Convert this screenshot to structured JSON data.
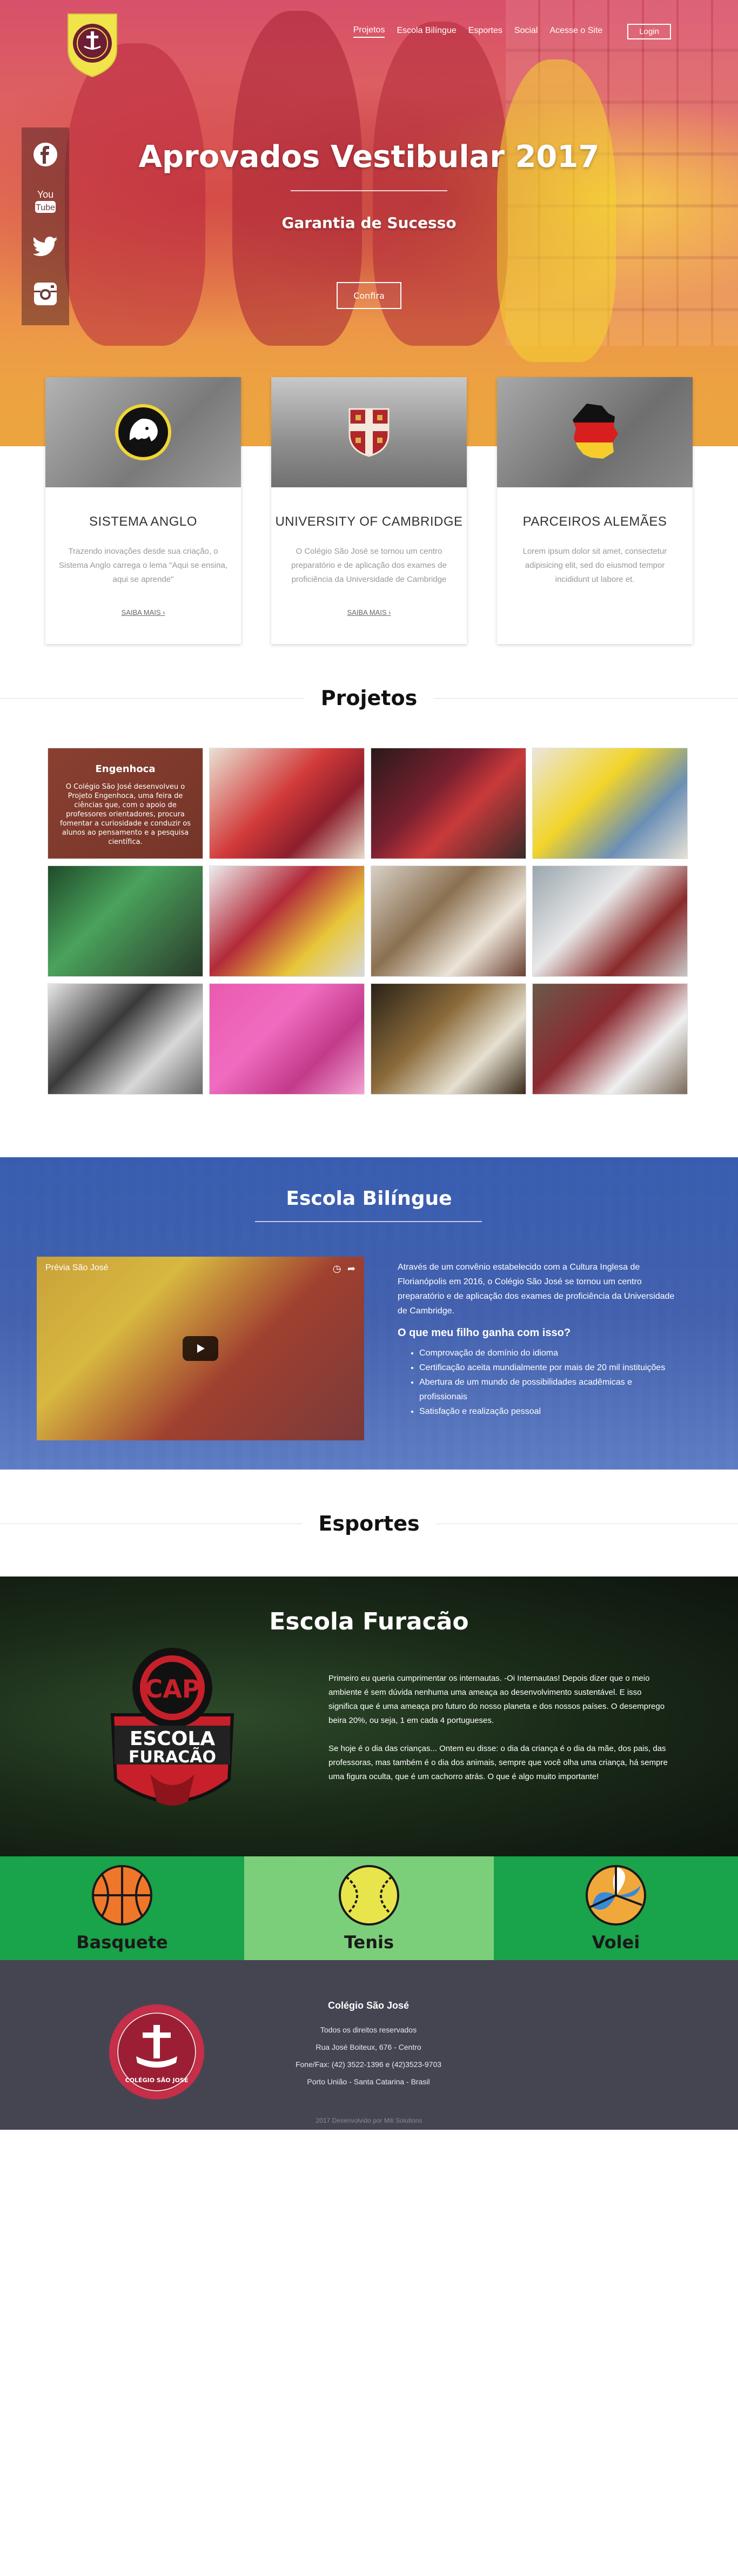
{
  "nav": {
    "items": [
      {
        "label": "Projetos",
        "active": true
      },
      {
        "label": "Escola Bilíngue",
        "active": false
      },
      {
        "label": "Esportes",
        "active": false
      },
      {
        "label": "Social",
        "active": false
      },
      {
        "label": "Acesse o Site",
        "active": false
      }
    ],
    "login": "Login"
  },
  "social": [
    "facebook-icon",
    "youtube-icon",
    "twitter-icon",
    "instagram-icon"
  ],
  "hero": {
    "title": "Aprovados Vestibular 2017",
    "subtitle": "Garantia de Sucesso",
    "button": "Confira"
  },
  "cards": [
    {
      "title": "SISTEMA ANGLO",
      "text": "Trazendo inovações desde sua criação, o Sistema Anglo carrega o lema \"Aqui se ensina, aqui se aprende\"",
      "more": "SAIBA MAIS ›",
      "icon": "lion-emblem-icon"
    },
    {
      "title": "UNIVERSITY OF CAMBRIDGE",
      "text": "O Colégio São José se tornou um centro preparatório e de aplicação dos exames de proficiência da Universidade de Cambridge",
      "more": "SAIBA MAIS ›",
      "icon": "cambridge-shield-icon"
    },
    {
      "title": "PARCEIROS ALEMÃES",
      "text": "Lorem ipsum dolor sit amet, consectetur adipisicing elit, sed do eiusmod tempor incididunt ut labore et.",
      "more": "",
      "icon": "german-map-icon"
    }
  ],
  "projetos": {
    "heading": "Projetos",
    "featured": {
      "title": "Engenhoca",
      "text": "O Colégio São José desenvolveu o Projeto Engenhoca, uma feira de ciências que, com o apoio de professores orientadores, procura fomentar a curiosidade e conduzir os alunos ao pensamento e a pesquisa científica."
    }
  },
  "bilingue": {
    "heading": "Escola Bilíngue",
    "video_title": "Prévia São José",
    "text": "Através de um convênio estabelecido com a Cultura Inglesa de Florianópolis em 2016, o Colégio São José se tornou um centro preparatório e de aplicação dos exames de proficiência da Universidade de Cambridge.",
    "question": "O que meu filho ganha com isso?",
    "bullets": [
      "Comprovação de domínio do idioma",
      "Certificação aceita mundialmente por mais de 20 mil instituições",
      "Abertura de um mundo de possibilidades acadêmicas e profissionais",
      "Satisfação e realização pessoal"
    ]
  },
  "esportes": {
    "heading": "Esportes",
    "furacao_title": "Escola Furacão",
    "p1": "Primeiro eu queria cumprimentar os internautas. -Oi Internautas! Depois dizer que o meio ambiente é sem dúvida nenhuma uma ameaça ao desenvolvimento sustentável. E isso significa que é uma ameaça pro futuro do nosso planeta e dos nossos países. O desemprego beira 20%, ou seja, 1 em cada 4 portugueses.",
    "p2": "Se hoje é o dia das crianças... Ontem eu disse: o dia da criança é o dia da mãe, dos pais, das professoras, mas também é o dia dos animais, sempre que você olha uma criança, há sempre uma figura oculta, que é um cachorro atrás. O que é algo muito importante!",
    "sports": [
      {
        "name": "Basquete",
        "icon": "basketball-icon"
      },
      {
        "name": "Tenis",
        "icon": "tennis-ball-icon"
      },
      {
        "name": "Volei",
        "icon": "volleyball-icon"
      }
    ]
  },
  "footer": {
    "name": "Colégio São José",
    "rights": "Todos os direitos reservados",
    "address": "Rua José Boiteux, 676 - Centro",
    "phone": "Fone/Fax: (42) 3522-1396 e (42)3523-9703",
    "city": "Porto União - Santa Catarina - Brasil",
    "copyright": "2017 Desenvolvido por Mili Solutions"
  },
  "colors": {
    "sports_green": "#19a34a",
    "sports_light": "#7ccf7a",
    "footer": "#454552",
    "bilingue_blue": "#2a52a8"
  }
}
